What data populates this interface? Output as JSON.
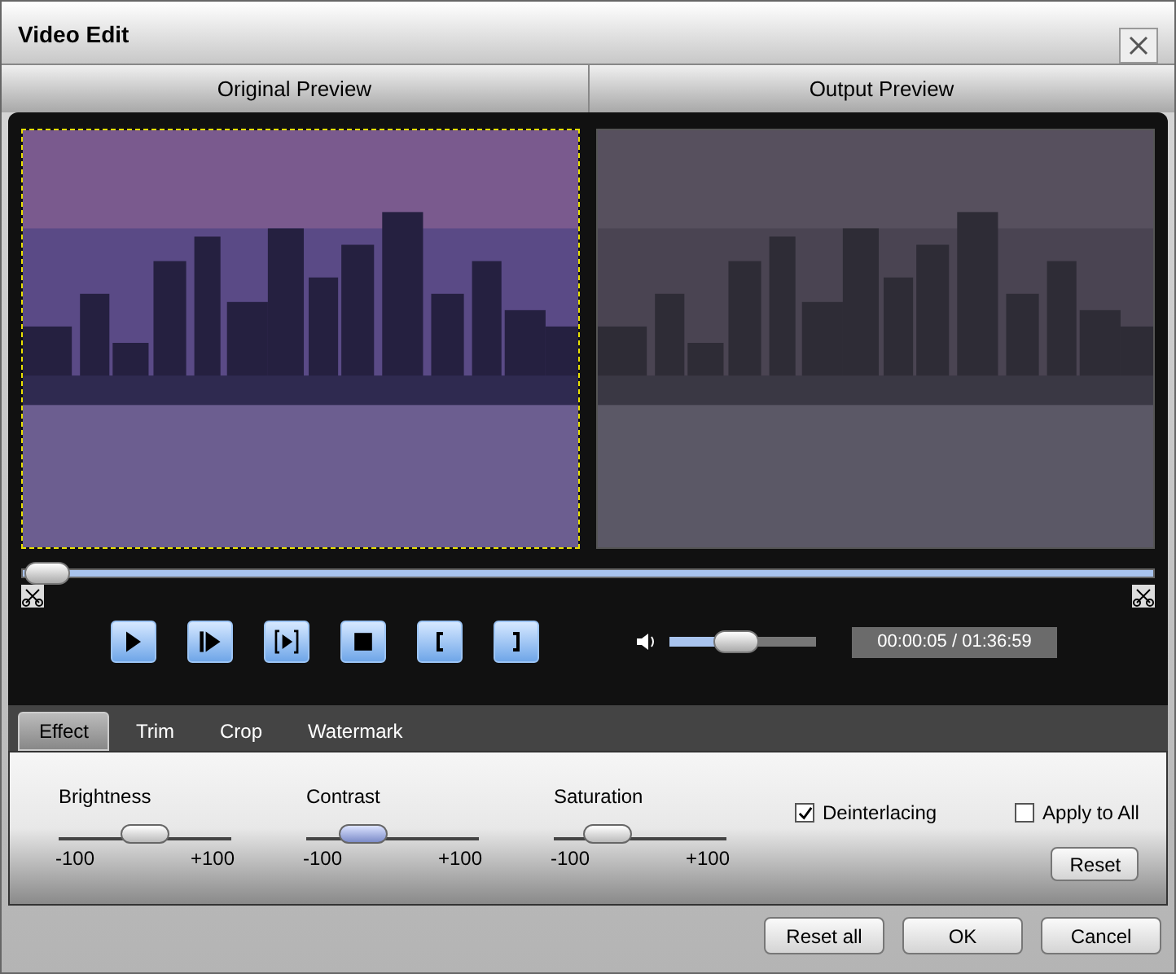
{
  "window": {
    "title": "Video Edit"
  },
  "preview_headers": [
    "Original Preview",
    "Output Preview"
  ],
  "seek": {
    "level": 0.01
  },
  "volume": {
    "level": 0.45
  },
  "time": "00:00:05 / 01:36:59",
  "tabs": [
    {
      "label": "Effect",
      "selected": true
    },
    {
      "label": "Trim",
      "selected": false
    },
    {
      "label": "Crop",
      "selected": false
    },
    {
      "label": "Watermark",
      "selected": false
    }
  ],
  "adjustments": [
    {
      "label": "Brightness",
      "min": "-100",
      "max": "+100",
      "level": 0.5,
      "focused": false
    },
    {
      "label": "Contrast",
      "min": "-100",
      "max": "+100",
      "level": 0.33,
      "focused": true
    },
    {
      "label": "Saturation",
      "min": "-100",
      "max": "+100",
      "level": 0.31,
      "focused": false
    }
  ],
  "deinterlacing": {
    "label": "Deinterlacing",
    "checked": true
  },
  "apply_to_all": {
    "label": "Apply to All",
    "checked": false
  },
  "reset": "Reset",
  "buttons": [
    "Reset all",
    "OK",
    "Cancel"
  ]
}
